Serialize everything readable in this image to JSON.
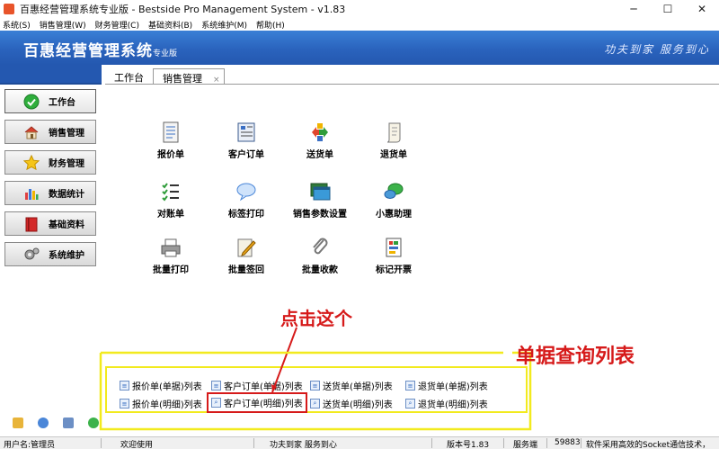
{
  "window": {
    "title": "百惠经营管理系统专业版 - Bestside Pro Management System - v1.83",
    "minimize": "─",
    "maximize": "☐",
    "close": "✕"
  },
  "menu": [
    "系统(S)",
    "销售管理(W)",
    "财务管理(C)",
    "基础资料(B)",
    "系统维护(M)",
    "帮助(H)"
  ],
  "banner": {
    "brand": "百惠经营管理系统",
    "edition": "专业版",
    "slogan": "功夫到家 服务到心"
  },
  "sidebar": {
    "items": [
      {
        "label": "工作台",
        "icon": "check-circle-icon"
      },
      {
        "label": "销售管理",
        "icon": "house-icon"
      },
      {
        "label": "财务管理",
        "icon": "star-icon"
      },
      {
        "label": "数据统计",
        "icon": "bar-chart-icon"
      },
      {
        "label": "基础资料",
        "icon": "book-icon"
      },
      {
        "label": "系统维护",
        "icon": "gears-icon"
      }
    ]
  },
  "tabs": [
    {
      "label": "工作台"
    },
    {
      "label": "销售管理",
      "close": "×"
    }
  ],
  "features": [
    {
      "label": "报价单",
      "icon": "document-icon"
    },
    {
      "label": "客户订单",
      "icon": "order-form-icon"
    },
    {
      "label": "送货单",
      "icon": "delivery-arrows-icon"
    },
    {
      "label": "退货单",
      "icon": "scroll-icon"
    },
    {
      "label": "对账单",
      "icon": "checklist-icon"
    },
    {
      "label": "标签打印",
      "icon": "speech-bubble-icon"
    },
    {
      "label": "销售参数设置",
      "icon": "window-settings-icon"
    },
    {
      "label": "小惠助理",
      "icon": "chat-bubbles-icon"
    },
    {
      "label": "批量打印",
      "icon": "printer-icon"
    },
    {
      "label": "批量签回",
      "icon": "pen-paper-icon"
    },
    {
      "label": "批量收款",
      "icon": "paperclip-icon"
    },
    {
      "label": "标记开票",
      "icon": "invoice-icon"
    }
  ],
  "lists": [
    {
      "label": "报价单(单据)列表"
    },
    {
      "label": "客户订单(单据)列表"
    },
    {
      "label": "送货单(单据)列表"
    },
    {
      "label": "退货单(单据)列表"
    },
    {
      "label": "报价单(明细)列表"
    },
    {
      "label": "客户订单(明细)列表"
    },
    {
      "label": "送货单(明细)列表"
    },
    {
      "label": "退货单(明细)列表"
    }
  ],
  "annotations": {
    "click_hint": "点击这个",
    "list_hint": "单据查询列表"
  },
  "status": {
    "user": "用户名:管理员",
    "welcome": "欢迎使用",
    "motto": "功夫到家 服务到心",
    "version": "版本号1.83",
    "server": "服务端",
    "port": "59883",
    "note": "软件采用高效的Socket通信技术，"
  },
  "colors": {
    "banner": "#2a63bd",
    "annotation": "#d61a1a",
    "highlight_box": "#f2ea1e"
  }
}
